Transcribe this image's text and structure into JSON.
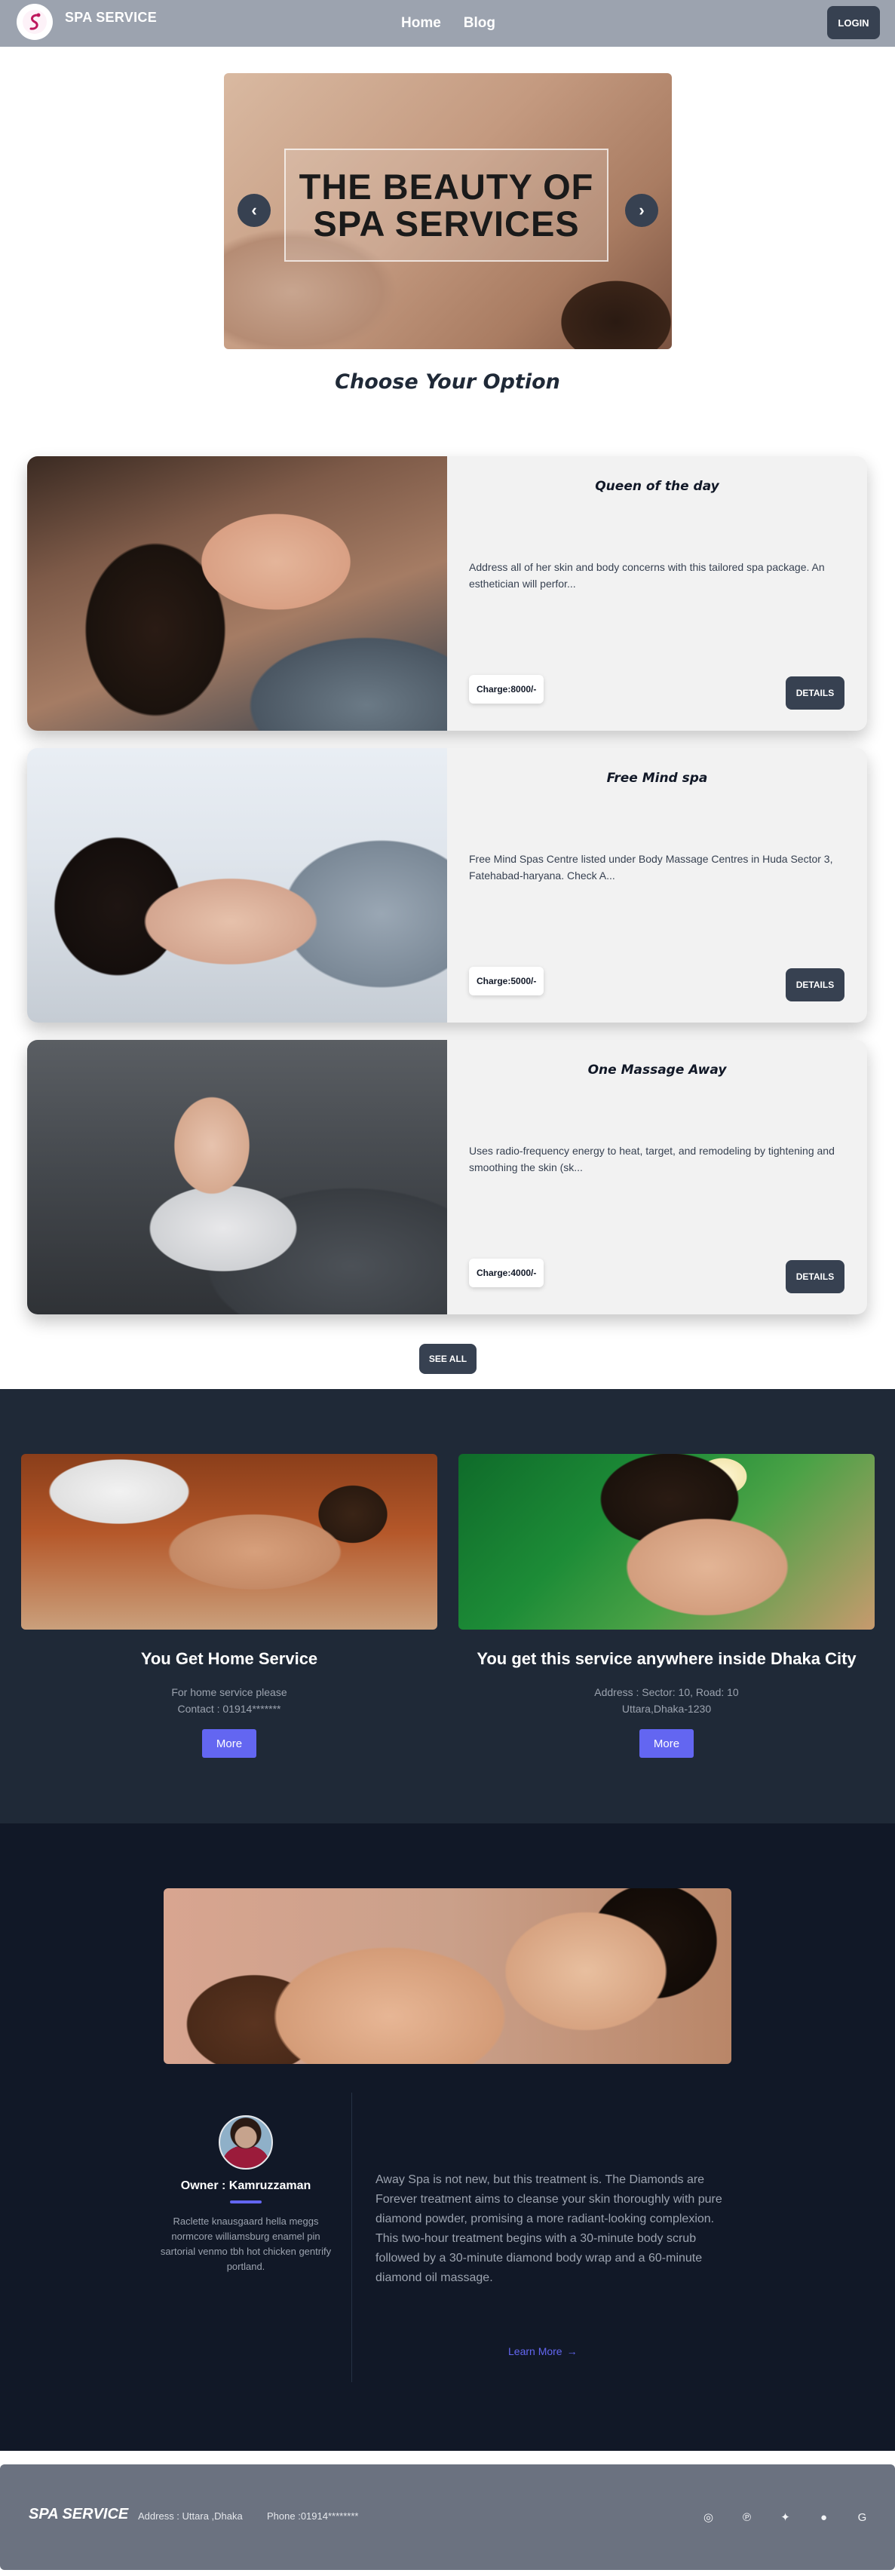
{
  "navbar": {
    "brand": "SPA SERVICE",
    "links": [
      "Home",
      "Blog"
    ],
    "login_label": "LOGIN"
  },
  "hero": {
    "caption_line1": "THE BEAUTY OF",
    "caption_line2": "SPA SERVICES",
    "prev_icon": "‹",
    "next_icon": "›"
  },
  "section_title": "Choose Your Option",
  "services": [
    {
      "title": "Queen of the day",
      "description": "Address all of her skin and body concerns with this tailored spa package. An esthetician will perfor...",
      "charge": "Charge:8000/-",
      "details_label": "DETAILS"
    },
    {
      "title": "Free Mind spa",
      "description": "Free Mind Spas Centre listed under Body Massage Centres in Huda Sector 3, Fatehabad-haryana. Check A...",
      "charge": "Charge:5000/-",
      "details_label": "DETAILS"
    },
    {
      "title": "One Massage Away",
      "description": "Uses radio-frequency energy to heat, target, and remodeling by tightening and smoothing the skin (sk...",
      "charge": "Charge:4000/-",
      "details_label": "DETAILS"
    }
  ],
  "see_all_label": "SEE ALL",
  "features": [
    {
      "title": "You Get Home Service",
      "line1": "For home service please",
      "line2": "Contact : 01914*******",
      "button": "More"
    },
    {
      "title": "You get this service anywhere inside Dhaka City",
      "line1": "Address : Sector: 10, Road: 10",
      "line2": "Uttara,Dhaka-1230",
      "button": "More"
    }
  ],
  "about": {
    "owner": "Owner : Kamruzzaman",
    "bio": "Raclette knausgaard hella meggs normcore williamsburg enamel pin sartorial venmo tbh hot chicken gentrify portland.",
    "text": "Away Spa is not new, but this treatment is. The Diamonds are Forever treatment aims to cleanse your skin thoroughly with pure diamond powder, promising a more radiant-looking complexion. This two-hour treatment begins with a 30-minute body scrub followed by a 30-minute diamond body wrap and a 60-minute diamond oil massage.",
    "learn_more": "Learn More",
    "arrow": "→"
  },
  "footer": {
    "brand": "SPA SERVICE",
    "address": "Address : Uttara ,Dhaka",
    "phone": "Phone :01914********",
    "socials": [
      {
        "name": "instagram-icon",
        "glyph": "◎"
      },
      {
        "name": "pinterest-icon",
        "glyph": "℗"
      },
      {
        "name": "twitter-icon",
        "glyph": "✦"
      },
      {
        "name": "facebook-icon",
        "glyph": "●"
      },
      {
        "name": "google-icon",
        "glyph": "G"
      }
    ]
  },
  "colors": {
    "navbar": "#9ca3af",
    "button_dark": "#374151",
    "band": "#1f2937",
    "about": "#111827",
    "accent": "#6366f1",
    "footer": "#6b7280"
  }
}
